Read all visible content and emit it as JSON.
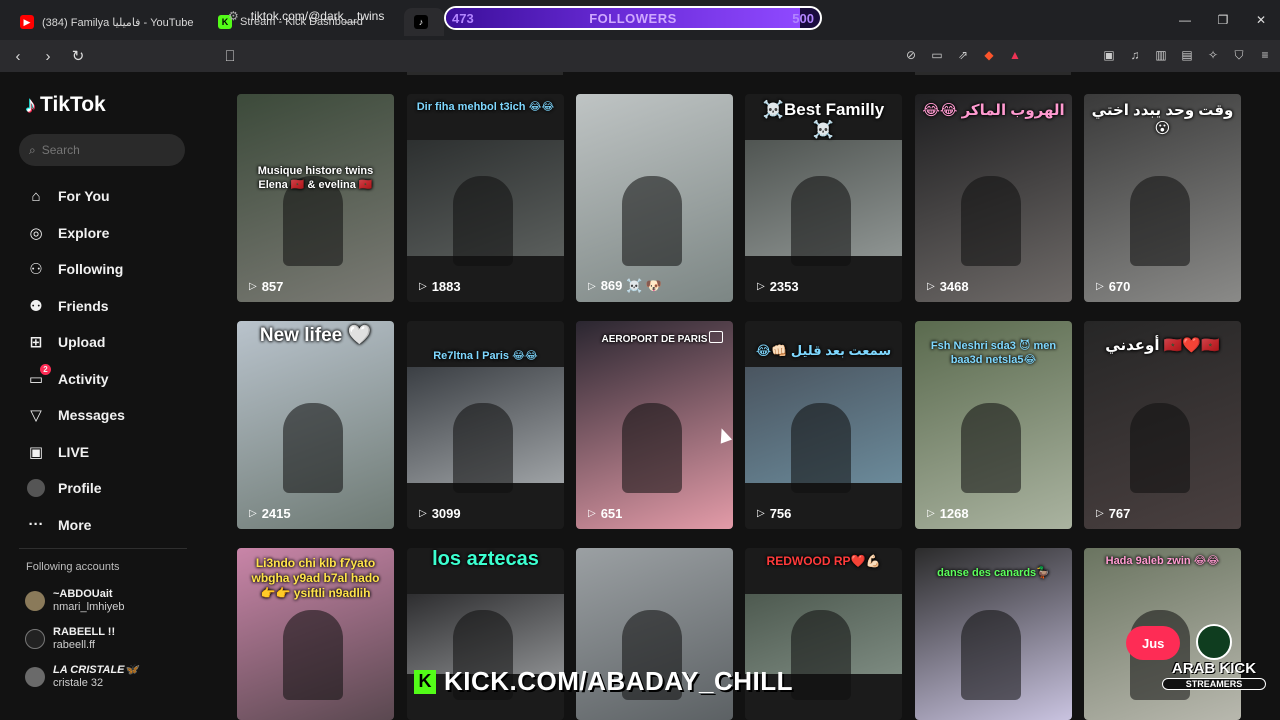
{
  "browser": {
    "tabs": [
      {
        "title": "(384) Familya فاميليا - YouTube",
        "fav": "▶",
        "fav_color": "#ff0000"
      },
      {
        "title": "Stream - Kick Dashboard",
        "fav": "K",
        "fav_color": "#53fc18"
      },
      {
        "title": "",
        "fav": "♪",
        "fav_color": "#000000"
      }
    ],
    "address": "tiktok.com/@dark__twins"
  },
  "followers_goal": {
    "current": "473",
    "label": "FOLLOWERS",
    "goal": "500",
    "progress": 0.946
  },
  "sidebar": {
    "logo": "TikTok",
    "search_placeholder": "Search",
    "nav": [
      {
        "label": "For You",
        "icon": "home-icon"
      },
      {
        "label": "Explore",
        "icon": "compass-icon"
      },
      {
        "label": "Following",
        "icon": "following-icon"
      },
      {
        "label": "Friends",
        "icon": "friends-icon"
      },
      {
        "label": "Upload",
        "icon": "upload-icon"
      },
      {
        "label": "Activity",
        "icon": "activity-icon",
        "badge": "2"
      },
      {
        "label": "Messages",
        "icon": "messages-icon"
      },
      {
        "label": "LIVE",
        "icon": "live-icon"
      },
      {
        "label": "Profile",
        "icon": "profile-icon"
      },
      {
        "label": "More",
        "icon": "more-icon"
      }
    ],
    "following_title": "Following accounts",
    "accounts": [
      {
        "name": "~ABDOUait",
        "handle": "nmari_lmhiyeb"
      },
      {
        "name": "RABEELL !!",
        "handle": "rabeell.ff"
      },
      {
        "name": "LA CRISTALE🦋",
        "handle": "cristale 32"
      }
    ]
  },
  "videos": [
    {
      "caption": "Musique histore twins Elena 🇲🇦 & evelina 🇲🇦",
      "views": "857"
    },
    {
      "caption": "Dir fiha mehbol t3ich 😂😂",
      "views": "1883"
    },
    {
      "caption": "",
      "views": "869 ☠️ 🐶"
    },
    {
      "caption": "☠️Best Familly ☠️",
      "views": "2353"
    },
    {
      "caption": "😂😂 الهروب الماكر",
      "views": "3468"
    },
    {
      "caption": "وقت وحد يبدد اختي 😮",
      "views": "670"
    },
    {
      "caption": "New lifee 🤍",
      "views": "2415"
    },
    {
      "caption": "Re7ltna l Paris 😂😂",
      "views": "3099"
    },
    {
      "caption": "AEROPORT DE PARIS",
      "views": "651"
    },
    {
      "caption": "😂👊🏻 سمعت بعد قليل",
      "views": "756"
    },
    {
      "caption": "Fsh Neshri sda3 😈 men baa3d netsla5😂",
      "views": "1268"
    },
    {
      "caption": "أوعدني 🇲🇦❤️🇲🇦",
      "views": "767"
    },
    {
      "caption": "Li3ndo chi klb f7yato wbgha y9ad b7al hado 👉👉 ysiftli n9adlih",
      "views": ""
    },
    {
      "caption": "los aztecas",
      "views": ""
    },
    {
      "caption": "",
      "views": ""
    },
    {
      "caption": "REDWOOD RP❤️💪🏻",
      "views": ""
    },
    {
      "caption": "danse des canards🦆",
      "views": ""
    },
    {
      "caption": "Hada 9aleb zwin 😂😂",
      "views": ""
    }
  ],
  "overlay": {
    "kick_url": "KICK.COM/ABADAY_CHILL",
    "jus_label": "Jus",
    "arab_kick": "ARAB KICK",
    "streamers": "STREAMERS"
  }
}
